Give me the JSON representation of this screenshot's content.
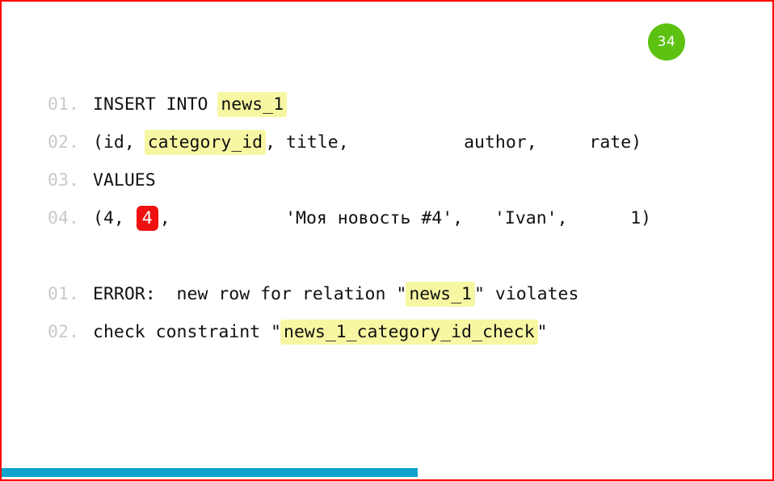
{
  "slide": {
    "border_color": "#ff0000",
    "background": "#ffffff"
  },
  "badge": {
    "name": "slide-number-badge",
    "label": "34",
    "fill_color": "#5cc110",
    "text_color": "#ffffff"
  },
  "sql_block": {
    "lines": [
      {
        "number": "01.",
        "parts": [
          {
            "text": "INSERT INTO ",
            "style": "plain"
          },
          {
            "text": "news_1",
            "style": "highlight-yellow"
          }
        ]
      },
      {
        "number": "02.",
        "parts": [
          {
            "text": "(id, ",
            "style": "plain"
          },
          {
            "text": "category_id",
            "style": "highlight-yellow"
          },
          {
            "text": ", title,           author,     rate)",
            "style": "plain"
          }
        ]
      },
      {
        "number": "03.",
        "parts": [
          {
            "text": "VALUES",
            "style": "plain"
          }
        ]
      },
      {
        "number": "04.",
        "parts": [
          {
            "text": "(4, ",
            "style": "plain"
          },
          {
            "text": "4",
            "style": "highlight-red"
          },
          {
            "text": ",           'Моя новость #4',   'Ivan',      1)",
            "style": "plain"
          }
        ]
      }
    ]
  },
  "error_block": {
    "lines": [
      {
        "number": "01.",
        "parts": [
          {
            "text": "ERROR:  new row for relation \"",
            "style": "plain"
          },
          {
            "text": "news_1",
            "style": "highlight-yellow"
          },
          {
            "text": "\" violates",
            "style": "plain"
          }
        ]
      },
      {
        "number": "02.",
        "parts": [
          {
            "text": "check constraint \"",
            "style": "plain"
          },
          {
            "text": "news_1_category_id_check",
            "style": "highlight-yellow"
          },
          {
            "text": "\"",
            "style": "plain"
          }
        ]
      }
    ]
  },
  "progress": {
    "name": "slide-progress-bar",
    "percent": 54,
    "fill_color": "#11a2cd"
  },
  "colors": {
    "highlight_yellow": "#f7f7a3",
    "highlight_red": "#ef1111",
    "line_number_gray": "#c9c9c9",
    "code_text": "#111111"
  }
}
